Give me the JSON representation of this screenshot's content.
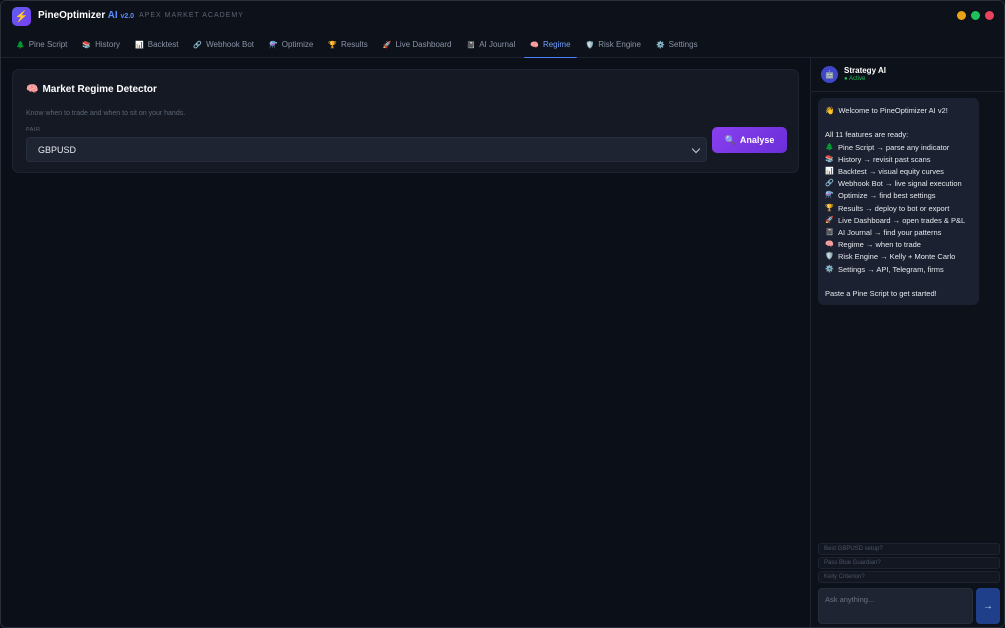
{
  "app": {
    "name": "PineOptimizer",
    "name_ai": "AI",
    "version": "v2.0",
    "subtitle": "APEX MARKET ACADEMY"
  },
  "colors": {
    "accent": "#4f7dff",
    "brand_purple": "#7b3ff2",
    "active_green": "#1fbf5c"
  },
  "tabs": [
    {
      "label": "Pine Script",
      "icon": "🌲"
    },
    {
      "label": "History",
      "icon": "📚"
    },
    {
      "label": "Backtest",
      "icon": "📊"
    },
    {
      "label": "Webhook Bot",
      "icon": "🔗"
    },
    {
      "label": "Optimize",
      "icon": "⚗️"
    },
    {
      "label": "Results",
      "icon": "🏆"
    },
    {
      "label": "Live Dashboard",
      "icon": "🚀"
    },
    {
      "label": "AI Journal",
      "icon": "📓"
    },
    {
      "label": "Regime",
      "icon": "🧠"
    },
    {
      "label": "Risk Engine",
      "icon": "🛡️"
    },
    {
      "label": "Settings",
      "icon": "⚙️"
    }
  ],
  "active_tab": "Regime",
  "regime": {
    "title_icon": "🧠",
    "title": "Market Regime Detector",
    "subtitle": "Know when to trade and when to sit on your hands.",
    "pair_label": "PAIR",
    "pair_value": "GBPUSD",
    "analyse_label": "Analyse",
    "analyse_icon": "🔍"
  },
  "chat": {
    "name": "Strategy AI",
    "status": "● Active",
    "avatar": "🤖",
    "message": {
      "greeting": "Welcome to PineOptimizer AI v2!",
      "greeting_icon": "👋",
      "intro": "All 11 features are ready:",
      "features": [
        {
          "icon": "🌲",
          "text": "Pine Script → parse any indicator"
        },
        {
          "icon": "📚",
          "text": "History → revisit past scans"
        },
        {
          "icon": "📊",
          "text": "Backtest → visual equity curves"
        },
        {
          "icon": "🔗",
          "text": "Webhook Bot → live signal execution"
        },
        {
          "icon": "⚗️",
          "text": "Optimize → find best settings"
        },
        {
          "icon": "🏆",
          "text": "Results → deploy to bot or export"
        },
        {
          "icon": "🚀",
          "text": "Live Dashboard → open trades & P&L"
        },
        {
          "icon": "📓",
          "text": "AI Journal → find your patterns"
        },
        {
          "icon": "🧠",
          "text": "Regime → when to trade"
        },
        {
          "icon": "🛡️",
          "text": "Risk Engine → Kelly + Monte Carlo"
        },
        {
          "icon": "⚙️",
          "text": "Settings → API, Telegram, firms"
        }
      ],
      "outro": "Paste a Pine Script to get started!"
    },
    "suggestions": [
      "Best GBPUSD setup?",
      "Pass Blue Guardian?",
      "Kelly Criterion?"
    ],
    "input_placeholder": "Ask anything...",
    "send_icon": "→"
  }
}
